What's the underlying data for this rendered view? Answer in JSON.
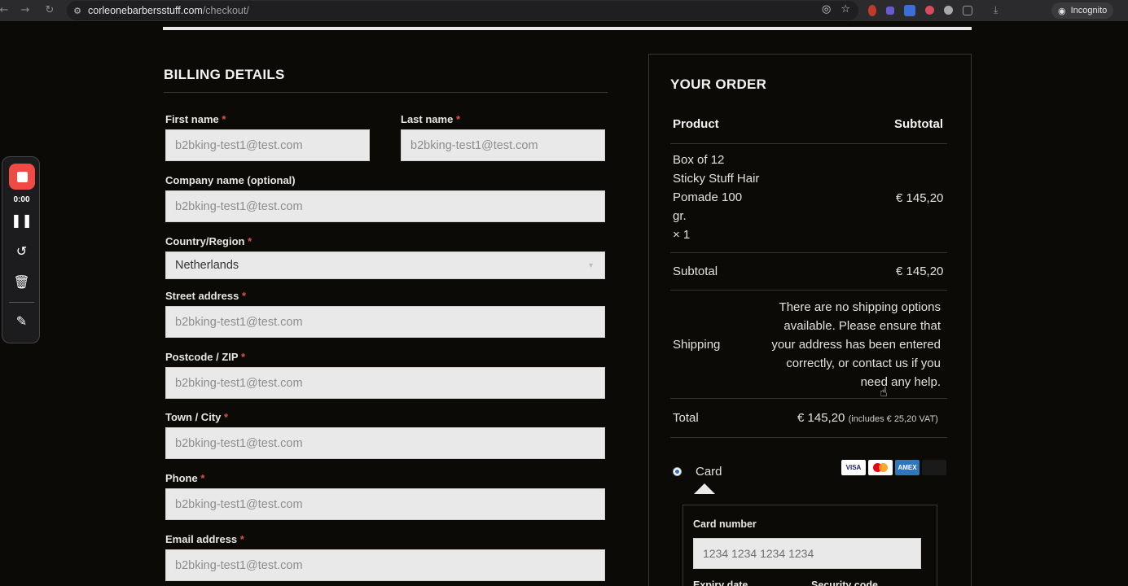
{
  "browser": {
    "url_domain": "corleonebarbersstuff.com",
    "url_path": "/checkout/",
    "incognito_label": "Incognito"
  },
  "recorder": {
    "time": "0:00"
  },
  "billing": {
    "title": "BILLING DETAILS",
    "required_mark": "*",
    "fields": {
      "first_name": {
        "label": "First name",
        "value": "b2bking-test1@test.com"
      },
      "last_name": {
        "label": "Last name",
        "value": "b2bking-test1@test.com"
      },
      "company": {
        "label": "Company name (optional)",
        "value": "b2bking-test1@test.com"
      },
      "country": {
        "label": "Country/Region",
        "value": "Netherlands"
      },
      "street": {
        "label": "Street address",
        "value": "b2bking-test1@test.com"
      },
      "postcode": {
        "label": "Postcode / ZIP",
        "value": "b2bking-test1@test.com"
      },
      "city": {
        "label": "Town / City",
        "value": "b2bking-test1@test.com"
      },
      "phone": {
        "label": "Phone",
        "value": "b2bking-test1@test.com"
      },
      "email": {
        "label": "Email address",
        "value": "b2bking-test1@test.com"
      }
    }
  },
  "order": {
    "title": "YOUR ORDER",
    "col_product": "Product",
    "col_subtotal": "Subtotal",
    "item_name_lines": [
      "Box of 12",
      "Sticky Stuff Hair",
      "Pomade 100",
      "gr."
    ],
    "item_qty": "× 1",
    "item_price": "€ 145,20",
    "subtotal_label": "Subtotal",
    "subtotal_value": "€ 145,20",
    "shipping_label": "Shipping",
    "shipping_message": "There are no shipping options available. Please ensure that your address has been entered correctly, or contact us if you need any help.",
    "total_label": "Total",
    "total_value": "€ 145,20",
    "total_vat_note": "(includes € 25,20 VAT)"
  },
  "payment": {
    "method_label": "Card",
    "brands": [
      "VISA",
      "Mastercard",
      "AMEX",
      ""
    ],
    "card_number_label": "Card number",
    "card_number_placeholder": "1234 1234 1234 1234",
    "expiry_label": "Expiry date",
    "security_label": "Security code"
  }
}
